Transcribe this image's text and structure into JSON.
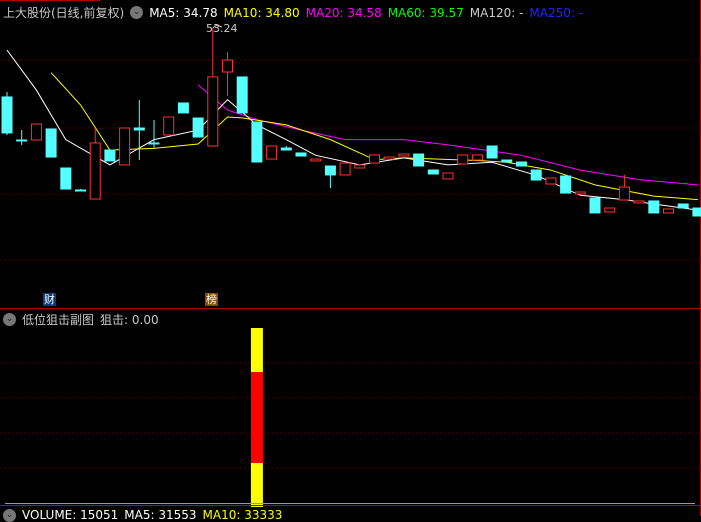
{
  "header": {
    "title": "上大股份(日线,前复权)",
    "ma5": "MA5: 34.78",
    "ma10": "MA10: 34.80",
    "ma20": "MA20: 34.58",
    "ma60": "MA60: 39.57",
    "ma120": "MA120: -",
    "ma250": "MA250: -"
  },
  "colors": {
    "up": "#ff3232",
    "down": "#54ffff",
    "ma5": "#ffffff",
    "ma10": "#ffff00",
    "ma20": "#ff00ff",
    "ma60": "#00ff00",
    "ma250": "#0000ff"
  },
  "high_label": "53.24",
  "tags": {
    "cai": "财",
    "bang": "榜"
  },
  "sub": {
    "title": "低位狙击副图",
    "value": "狙击: 0.00"
  },
  "volume": {
    "label": "VOLUME: 15051",
    "ma5": "MA5: 31553",
    "ma10": "MA10: 33333"
  },
  "chart_data": {
    "type": "candlestick",
    "candles": [
      [
        45.31,
        41.17,
        45.88,
        40.94
      ],
      [
        40.36,
        40.36,
        41.51,
        39.79
      ],
      [
        40.36,
        42.2,
        42.2,
        40.36
      ],
      [
        41.63,
        38.4,
        41.63,
        38.4
      ],
      [
        37.14,
        34.72,
        37.14,
        34.72
      ],
      [
        34.61,
        34.61,
        34.72,
        34.61
      ],
      [
        33.57,
        40.02,
        41.74,
        33.57
      ],
      [
        39.21,
        37.95,
        39.21,
        37.95
      ],
      [
        37.49,
        41.74,
        41.74,
        37.49
      ],
      [
        41.74,
        41.51,
        44.96,
        38.06
      ],
      [
        40.02,
        40.02,
        42.66,
        39.44
      ],
      [
        40.94,
        43.01,
        43.01,
        40.94
      ],
      [
        44.62,
        43.47,
        44.62,
        43.47
      ],
      [
        42.89,
        40.7,
        42.89,
        40.7
      ],
      [
        39.67,
        47.61,
        53.24,
        39.67
      ],
      [
        48.18,
        49.56,
        50.48,
        45.42
      ],
      [
        47.61,
        43.47,
        47.61,
        43.47
      ],
      [
        42.43,
        37.83,
        42.43,
        37.83
      ],
      [
        38.17,
        39.67,
        39.67,
        38.17
      ],
      [
        39.44,
        39.21,
        39.67,
        39.21
      ],
      [
        38.87,
        38.52,
        38.87,
        38.52
      ],
      [
        37.95,
        38.17,
        38.17,
        37.95
      ],
      [
        37.37,
        36.34,
        37.37,
        34.84
      ],
      [
        36.34,
        37.71,
        37.71,
        36.34
      ],
      [
        37.14,
        37.49,
        37.49,
        37.14
      ],
      [
        37.71,
        38.64,
        38.64,
        37.71
      ],
      [
        38.17,
        38.4,
        38.4,
        38.17
      ],
      [
        38.52,
        38.75,
        38.75,
        38.52
      ],
      [
        38.75,
        37.37,
        38.75,
        37.37
      ],
      [
        36.91,
        36.45,
        36.91,
        36.45
      ],
      [
        35.88,
        36.57,
        36.57,
        35.88
      ],
      [
        37.6,
        38.64,
        38.64,
        37.6
      ],
      [
        38.06,
        38.64,
        38.64,
        38.06
      ],
      [
        39.67,
        38.29,
        39.67,
        38.29
      ],
      [
        38.06,
        37.83,
        38.06,
        37.83
      ],
      [
        37.83,
        37.37,
        37.83,
        37.37
      ],
      [
        36.91,
        35.76,
        36.91,
        35.76
      ],
      [
        35.3,
        35.99,
        35.99,
        35.3
      ],
      [
        36.22,
        34.26,
        36.22,
        34.26
      ],
      [
        34.15,
        34.38,
        34.38,
        34.15
      ],
      [
        33.69,
        31.97,
        33.69,
        31.97
      ],
      [
        32.08,
        32.54,
        32.54,
        32.08
      ],
      [
        33.46,
        34.95,
        36.34,
        33.46
      ],
      [
        33.12,
        33.35,
        33.35,
        33.12
      ],
      [
        33.35,
        31.97,
        33.35,
        31.97
      ],
      [
        31.97,
        32.43,
        32.43,
        31.97
      ],
      [
        33.0,
        32.54,
        33.0,
        32.54
      ],
      [
        32.54,
        31.62,
        32.54,
        31.62
      ]
    ],
    "ma5": [
      [
        0,
        50.7
      ],
      [
        2,
        46.1
      ],
      [
        4,
        40.4
      ],
      [
        7,
        37.5
      ],
      [
        10,
        40.4
      ],
      [
        13,
        41.5
      ],
      [
        15,
        45.0
      ],
      [
        17,
        42.1
      ],
      [
        19,
        40.4
      ],
      [
        21,
        38.6
      ],
      [
        24,
        37.5
      ],
      [
        27,
        38.3
      ],
      [
        30,
        37.5
      ],
      [
        33,
        37.8
      ],
      [
        36,
        36.3
      ],
      [
        39,
        34.0
      ],
      [
        42,
        33.5
      ],
      [
        44,
        33.0
      ],
      [
        47,
        32.3
      ]
    ],
    "ma10": [
      [
        3,
        48.1
      ],
      [
        5,
        44.4
      ],
      [
        7,
        39.2
      ],
      [
        10,
        39.4
      ],
      [
        13,
        39.9
      ],
      [
        15,
        43.0
      ],
      [
        16,
        42.9
      ],
      [
        19,
        42.1
      ],
      [
        22,
        40.4
      ],
      [
        25,
        38.1
      ],
      [
        27,
        38.3
      ],
      [
        32,
        38.0
      ],
      [
        34,
        37.8
      ],
      [
        37,
        36.9
      ],
      [
        40,
        35.2
      ],
      [
        44,
        33.9
      ],
      [
        47,
        33.5
      ]
    ],
    "ma20": [
      [
        13,
        46.7
      ],
      [
        15,
        43.8
      ],
      [
        17,
        42.7
      ],
      [
        20,
        41.5
      ],
      [
        23,
        40.4
      ],
      [
        27,
        40.4
      ],
      [
        30,
        39.8
      ],
      [
        35,
        38.6
      ],
      [
        39,
        36.9
      ],
      [
        43,
        35.8
      ],
      [
        47,
        35.2
      ]
    ],
    "signal": {
      "index": 17,
      "segments": [
        "#ffff00",
        "#ff0000",
        "#ffff00"
      ]
    }
  }
}
